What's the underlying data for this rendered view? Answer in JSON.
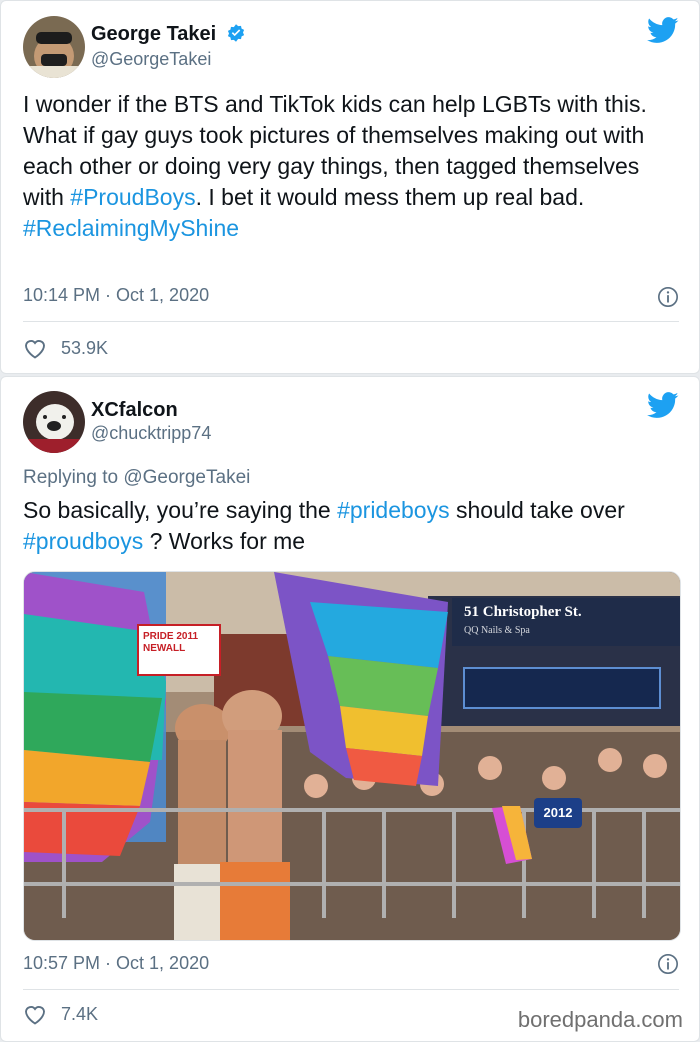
{
  "tweets": [
    {
      "name": "George Takei",
      "handle": "@GeorgeTakei",
      "verified": true,
      "text": {
        "before_hashtag": "I wonder if the BTS and TikTok kids can help LGBTs with this. What if gay guys took pictures of themselves making out with each other or doing very gay things, then tagged themselves with ",
        "hashtag1": "#ProudBoys",
        "after_hashtag": ". I bet it would mess them up real bad.",
        "hashtag2": "#ReclaimingMyShine"
      },
      "timestamp": "10:14 PM · Oct 1, 2020",
      "likes": "53.9K"
    },
    {
      "name": "XCfalcon",
      "handle": "@chucktripp74",
      "reply_to": "Replying to @GeorgeTakei",
      "text": {
        "part1": "So basically, you’re saying the ",
        "hashtag1": "#prideboys",
        "part2": " should take over ",
        "hashtag2": "#proudboys",
        "part3": " ?  Works for me"
      },
      "photo": {
        "store_sign": "51 Christopher St.",
        "store_sub": "QQ Nails & Spa",
        "banner": "PRIDE 2011 NEWALL",
        "badge": "2012"
      },
      "timestamp": "10:57 PM · Oct 1, 2020",
      "likes": "7.4K"
    }
  ],
  "watermark": "boredpanda.com",
  "colors": {
    "twitter_blue": "#1da1f2",
    "hashtag_blue": "#1b95e0",
    "muted_text": "#5b7083"
  },
  "icons": [
    "twitter-bird-icon",
    "verified-badge-icon",
    "info-icon",
    "heart-icon"
  ]
}
